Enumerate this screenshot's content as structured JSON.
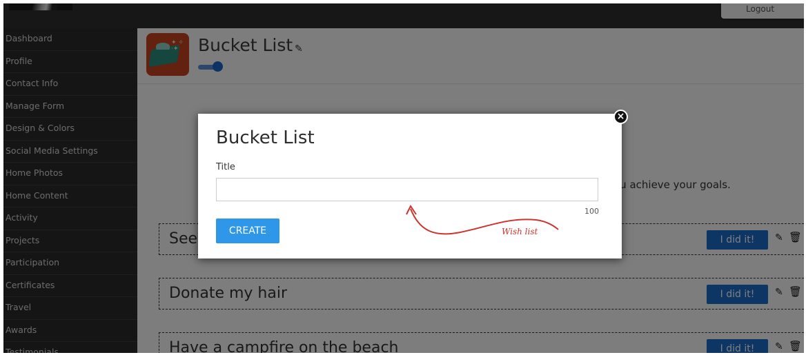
{
  "topbar": {
    "logout_label": "Logout"
  },
  "sidebar": {
    "items": [
      {
        "label": "Dashboard"
      },
      {
        "label": "Profile"
      },
      {
        "label": "Contact Info"
      },
      {
        "label": "Manage Form"
      },
      {
        "label": "Design & Colors"
      },
      {
        "label": "Social Media Settings"
      },
      {
        "label": "Home Photos"
      },
      {
        "label": "Home Content"
      },
      {
        "label": "Activity"
      },
      {
        "label": "Projects"
      },
      {
        "label": "Participation"
      },
      {
        "label": "Certificates"
      },
      {
        "label": "Travel"
      },
      {
        "label": "Awards"
      },
      {
        "label": "Testimonials"
      }
    ]
  },
  "header": {
    "title": "Bucket List",
    "edit_icon": "pencil-icon",
    "toggle_on": true
  },
  "main": {
    "intro_text_visible": "ou achieve your goals.",
    "items": [
      {
        "title": "See",
        "action_label": "I did it!"
      },
      {
        "title": "Donate my hair",
        "action_label": "I did it!"
      },
      {
        "title": "Have a campfire on the beach",
        "action_label": "I did it!"
      }
    ]
  },
  "modal": {
    "title": "Bucket List",
    "field_label": "Title",
    "field_value": "",
    "char_limit": "100",
    "submit_label": "CREATE",
    "annotation": "Wish list"
  },
  "colors": {
    "accent_blue": "#2e97ea",
    "button_blue": "#1a6cc8",
    "sidebar_bg": "#2b2b2b",
    "annotation_red": "#d0322b"
  }
}
